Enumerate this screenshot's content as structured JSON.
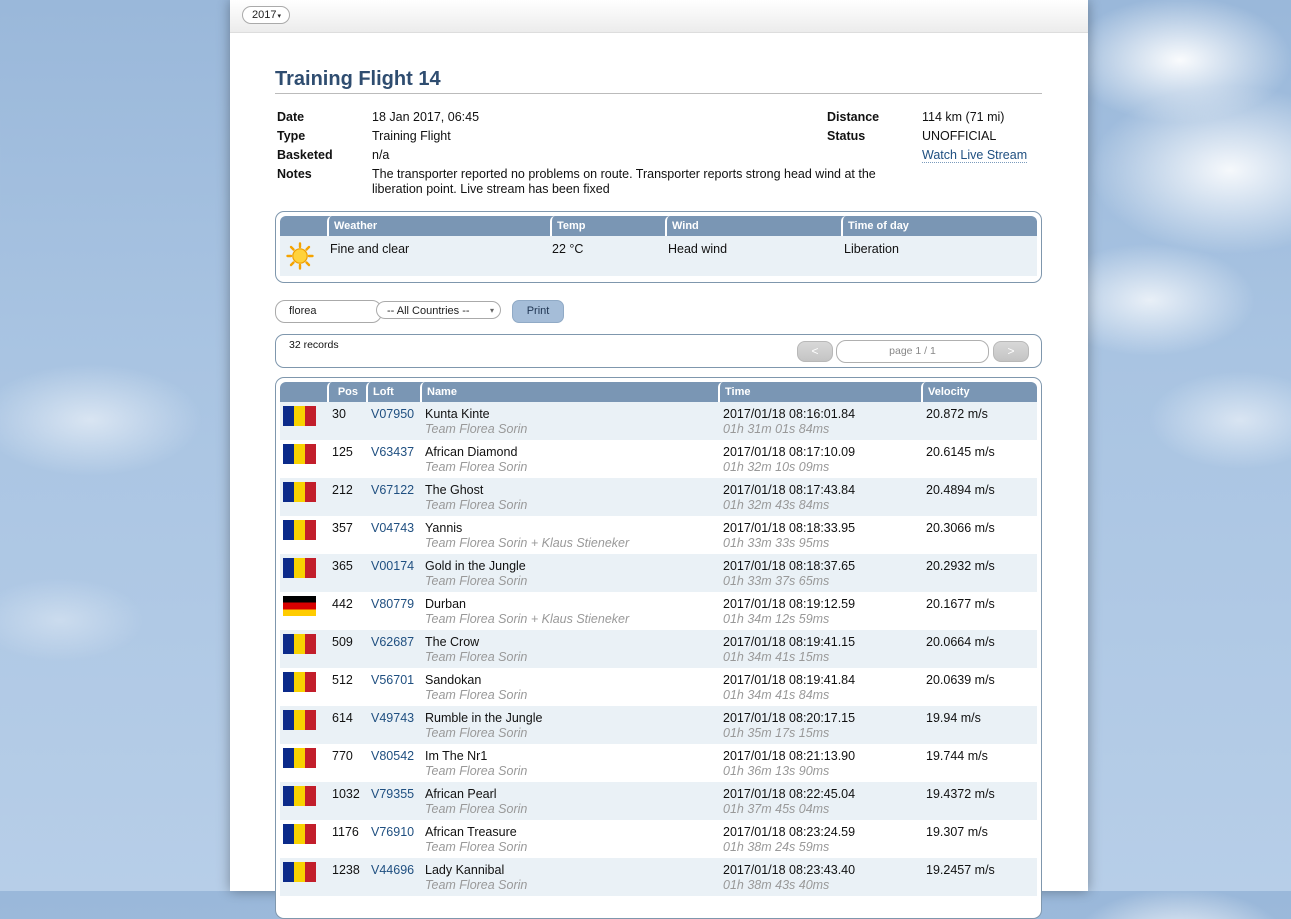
{
  "year": {
    "selected": "2017",
    "caret": "▾"
  },
  "title": "Training Flight 14",
  "details": {
    "date_label": "Date",
    "date": "18 Jan 2017, 06:45",
    "type_label": "Type",
    "type": "Training Flight",
    "basketed_label": "Basketed",
    "basketed": "n/a",
    "notes_label": "Notes",
    "notes": "The transporter reported no problems on route. Transporter reports strong head wind at the liberation point. Live stream has been fixed",
    "distance_label": "Distance",
    "distance": "114 km (71 mi)",
    "status_label": "Status",
    "status": "UNOFFICIAL",
    "stream_link": "Watch Live Stream"
  },
  "weather": {
    "headers": {
      "weather": "Weather",
      "temp": "Temp",
      "wind": "Wind",
      "time_of_day": "Time of day"
    },
    "icon": "sun-icon",
    "condition": "Fine and clear",
    "temp": "22 °C",
    "wind": "Head wind",
    "time_of_day": "Liberation"
  },
  "controls": {
    "search_value": "florea",
    "country_select": "-- All Countries --",
    "country_caret": "▾",
    "print_label": "Print"
  },
  "records": {
    "count": "32 records",
    "prev": "<",
    "next": ">",
    "page": "page 1 / 1"
  },
  "table": {
    "headers": {
      "pos": "Pos",
      "loft": "Loft",
      "name": "Name",
      "time": "Time",
      "velocity": "Velocity"
    },
    "rows": [
      {
        "flag": "ro",
        "pos": "30",
        "loft": "V07950",
        "name": "Kunta Kinte",
        "team": "Team Florea Sorin",
        "time": "2017/01/18 08:16:01.84",
        "dur": "01h 31m 01s 84ms",
        "vel": "20.872 m/s"
      },
      {
        "flag": "ro",
        "pos": "125",
        "loft": "V63437",
        "name": "African Diamond",
        "team": "Team Florea Sorin",
        "time": "2017/01/18 08:17:10.09",
        "dur": "01h 32m 10s 09ms",
        "vel": "20.6145 m/s"
      },
      {
        "flag": "ro",
        "pos": "212",
        "loft": "V67122",
        "name": "The Ghost",
        "team": "Team Florea Sorin",
        "time": "2017/01/18 08:17:43.84",
        "dur": "01h 32m 43s 84ms",
        "vel": "20.4894 m/s"
      },
      {
        "flag": "ro",
        "pos": "357",
        "loft": "V04743",
        "name": "Yannis",
        "team": "Team Florea Sorin + Klaus Stieneker",
        "time": "2017/01/18 08:18:33.95",
        "dur": "01h 33m 33s 95ms",
        "vel": "20.3066 m/s"
      },
      {
        "flag": "ro",
        "pos": "365",
        "loft": "V00174",
        "name": "Gold in the Jungle",
        "team": "Team Florea Sorin",
        "time": "2017/01/18 08:18:37.65",
        "dur": "01h 33m 37s 65ms",
        "vel": "20.2932 m/s"
      },
      {
        "flag": "de",
        "pos": "442",
        "loft": "V80779",
        "name": "Durban",
        "team": "Team Florea Sorin + Klaus Stieneker",
        "time": "2017/01/18 08:19:12.59",
        "dur": "01h 34m 12s 59ms",
        "vel": "20.1677 m/s"
      },
      {
        "flag": "ro",
        "pos": "509",
        "loft": "V62687",
        "name": "The Crow",
        "team": "Team Florea Sorin",
        "time": "2017/01/18 08:19:41.15",
        "dur": "01h 34m 41s 15ms",
        "vel": "20.0664 m/s"
      },
      {
        "flag": "ro",
        "pos": "512",
        "loft": "V56701",
        "name": "Sandokan",
        "team": "Team Florea Sorin",
        "time": "2017/01/18 08:19:41.84",
        "dur": "01h 34m 41s 84ms",
        "vel": "20.0639 m/s"
      },
      {
        "flag": "ro",
        "pos": "614",
        "loft": "V49743",
        "name": "Rumble in the Jungle",
        "team": "Team Florea Sorin",
        "time": "2017/01/18 08:20:17.15",
        "dur": "01h 35m 17s 15ms",
        "vel": "19.94 m/s"
      },
      {
        "flag": "ro",
        "pos": "770",
        "loft": "V80542",
        "name": "Im The Nr1",
        "team": "Team Florea Sorin",
        "time": "2017/01/18 08:21:13.90",
        "dur": "01h 36m 13s 90ms",
        "vel": "19.744 m/s"
      },
      {
        "flag": "ro",
        "pos": "1032",
        "loft": "V79355",
        "name": "African Pearl",
        "team": "Team Florea Sorin",
        "time": "2017/01/18 08:22:45.04",
        "dur": "01h 37m 45s 04ms",
        "vel": "19.4372 m/s"
      },
      {
        "flag": "ro",
        "pos": "1176",
        "loft": "V76910",
        "name": "African Treasure",
        "team": "Team Florea Sorin",
        "time": "2017/01/18 08:23:24.59",
        "dur": "01h 38m 24s 59ms",
        "vel": "19.307 m/s"
      },
      {
        "flag": "ro",
        "pos": "1238",
        "loft": "V44696",
        "name": "Lady Kannibal",
        "team": "Team Florea Sorin",
        "time": "2017/01/18 08:23:43.40",
        "dur": "01h 38m 43s 40ms",
        "vel": "19.2457 m/s"
      }
    ]
  }
}
